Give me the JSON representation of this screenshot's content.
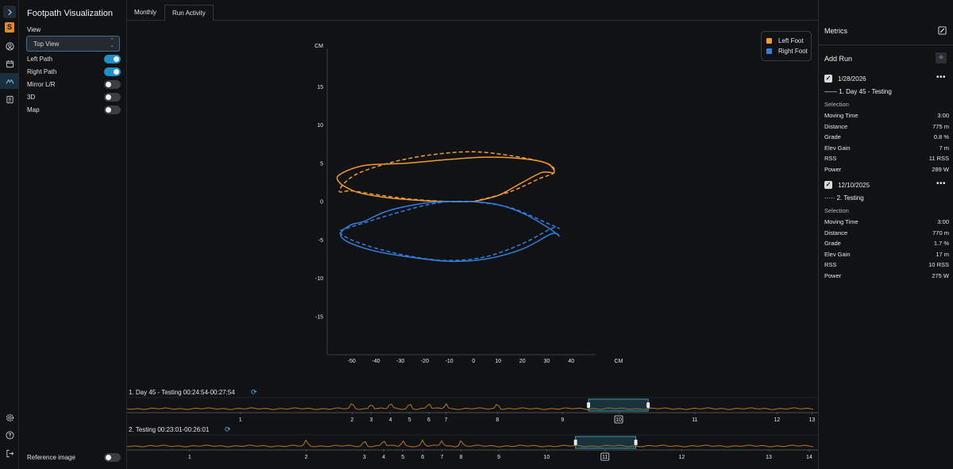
{
  "sidebar": {
    "icons": [
      "chevron-right-icon",
      "logo-s-icon",
      "user-circle-icon",
      "calendar-icon",
      "footpath-icon",
      "notebook-icon",
      "settings-icon",
      "help-icon",
      "logout-icon"
    ],
    "logo_letter": "S"
  },
  "left_panel": {
    "title": "Footpath Visualization",
    "view_label": "View",
    "view_value": "Top View",
    "options": [
      {
        "label": "Left Path",
        "on": true
      },
      {
        "label": "Right Path",
        "on": true
      },
      {
        "label": "Mirror L/R",
        "on": false
      },
      {
        "label": "3D",
        "on": false
      },
      {
        "label": "Map",
        "on": false
      }
    ],
    "reference_label": "Reference image",
    "reference_on": false
  },
  "tabs": [
    {
      "label": "Monthly",
      "active": false
    },
    {
      "label": "Run Activity",
      "active": true
    }
  ],
  "chart_data": {
    "type": "line",
    "x_unit": "CM",
    "y_unit": "CM",
    "xlim": [
      -60,
      50
    ],
    "ylim": [
      -20,
      20
    ],
    "x_ticks": [
      -50,
      -40,
      -30,
      -20,
      -10,
      0,
      10,
      20,
      30,
      40
    ],
    "y_ticks": [
      15,
      10,
      5,
      0,
      -5,
      -10,
      -15
    ],
    "legend": [
      {
        "name": "Left Foot",
        "color": "#f29a2e"
      },
      {
        "name": "Right Foot",
        "color": "#2f7fe0"
      }
    ],
    "series": [
      {
        "name": "Left Foot",
        "style": "solid",
        "color": "#f29a2e",
        "x": [
          0,
          10,
          20,
          28,
          33,
          30,
          20,
          5,
          -10,
          -28,
          -45,
          -55,
          -55,
          -50,
          -45,
          -35,
          -20,
          -10,
          0
        ],
        "y": [
          0,
          0.8,
          2.5,
          3.8,
          3.8,
          5,
          5.6,
          5.8,
          5.5,
          5,
          4.7,
          3.5,
          2.5,
          1.5,
          1,
          0.5,
          0.1,
          0,
          0
        ]
      },
      {
        "name": "Left Foot",
        "style": "dashed",
        "color": "#f29a2e",
        "x": [
          0,
          15,
          27,
          33,
          30,
          15,
          0,
          -15,
          -30,
          -45,
          -52,
          -55,
          -50,
          -40,
          -25,
          -10,
          0
        ],
        "y": [
          0,
          1.3,
          3,
          3.8,
          5,
          6,
          6.5,
          6.2,
          5.4,
          4,
          2.7,
          1.3,
          1.4,
          0.9,
          0.3,
          0,
          0
        ]
      },
      {
        "name": "Right Foot",
        "style": "solid",
        "color": "#2f7fe0",
        "x": [
          0,
          10,
          20,
          30,
          35,
          32,
          20,
          5,
          -10,
          -25,
          -40,
          -50,
          -54,
          -54,
          -50,
          -45,
          -35,
          -20,
          -10,
          0
        ],
        "y": [
          0,
          -0.4,
          -1.5,
          -3.3,
          -4.5,
          -4.2,
          -6.2,
          -7.5,
          -7.8,
          -7.3,
          -6.5,
          -5.5,
          -4.7,
          -3.9,
          -3,
          -2.6,
          -1.2,
          -0.2,
          0,
          0
        ]
      },
      {
        "name": "Right Foot",
        "style": "dashed",
        "color": "#2f7fe0",
        "x": [
          0,
          15,
          30,
          35,
          32,
          20,
          5,
          -10,
          -25,
          -40,
          -50,
          -55,
          -52,
          -45,
          -35,
          -20,
          -10,
          0
        ],
        "y": [
          0,
          -0.8,
          -2.8,
          -3.5,
          -3.5,
          -5.5,
          -7.2,
          -7.7,
          -7.2,
          -6.1,
          -5,
          -4,
          -3.5,
          -2.8,
          -1.8,
          -0.5,
          0,
          0
        ]
      }
    ]
  },
  "timelines": [
    {
      "title": "1. Day 45 - Testing 00:24:54-00:27:54",
      "markers": [
        {
          "label": "1",
          "pos": 0.163
        },
        {
          "label": "2",
          "pos": 0.326
        },
        {
          "label": "3",
          "pos": 0.354
        },
        {
          "label": "4",
          "pos": 0.382
        },
        {
          "label": "5",
          "pos": 0.41
        },
        {
          "label": "6",
          "pos": 0.438
        },
        {
          "label": "7",
          "pos": 0.463
        },
        {
          "label": "8",
          "pos": 0.538
        },
        {
          "label": "9",
          "pos": 0.633
        },
        {
          "label": "10",
          "pos": 0.715
        },
        {
          "label": "11",
          "pos": 0.826
        },
        {
          "label": "12",
          "pos": 0.946
        },
        {
          "label": "13",
          "pos": 0.997
        }
      ],
      "selected_marker": "10",
      "window": [
        0.671,
        0.758
      ]
    },
    {
      "title": "2. Testing 00:23:01-00:26:01",
      "markers": [
        {
          "label": "1",
          "pos": 0.089
        },
        {
          "label": "2",
          "pos": 0.259
        },
        {
          "label": "3",
          "pos": 0.344
        },
        {
          "label": "4",
          "pos": 0.372
        },
        {
          "label": "5",
          "pos": 0.4
        },
        {
          "label": "6",
          "pos": 0.429
        },
        {
          "label": "7",
          "pos": 0.457
        },
        {
          "label": "8",
          "pos": 0.485
        },
        {
          "label": "9",
          "pos": 0.54
        },
        {
          "label": "10",
          "pos": 0.61
        },
        {
          "label": "11",
          "pos": 0.695
        },
        {
          "label": "12",
          "pos": 0.807
        },
        {
          "label": "13",
          "pos": 0.934
        },
        {
          "label": "14",
          "pos": 0.993
        }
      ],
      "selected_marker": "11",
      "window": [
        0.652,
        0.74
      ]
    }
  ],
  "metrics": {
    "title": "Metrics",
    "add_run_label": "Add Run",
    "runs": [
      {
        "date": "1/28/2026",
        "line_style": "solid",
        "name": "1. Day 45 - Testing",
        "selection_label": "Selection",
        "rows": [
          {
            "k": "Moving Time",
            "v": "3:00"
          },
          {
            "k": "Distance",
            "v": "775 m"
          },
          {
            "k": "Grade",
            "v": "0.8 %"
          },
          {
            "k": "Elev Gain",
            "v": "7 m"
          },
          {
            "k": "RSS",
            "v": "11 RSS"
          },
          {
            "k": "Power",
            "v": "289 W"
          }
        ]
      },
      {
        "date": "12/10/2025",
        "line_style": "dotted",
        "name": "2. Testing",
        "selection_label": "Selection",
        "rows": [
          {
            "k": "Moving Time",
            "v": "3:00"
          },
          {
            "k": "Distance",
            "v": "770 m"
          },
          {
            "k": "Grade",
            "v": "1.7 %"
          },
          {
            "k": "Elev Gain",
            "v": "17 m"
          },
          {
            "k": "RSS",
            "v": "10 RSS"
          },
          {
            "k": "Power",
            "v": "275 W"
          }
        ]
      }
    ]
  }
}
